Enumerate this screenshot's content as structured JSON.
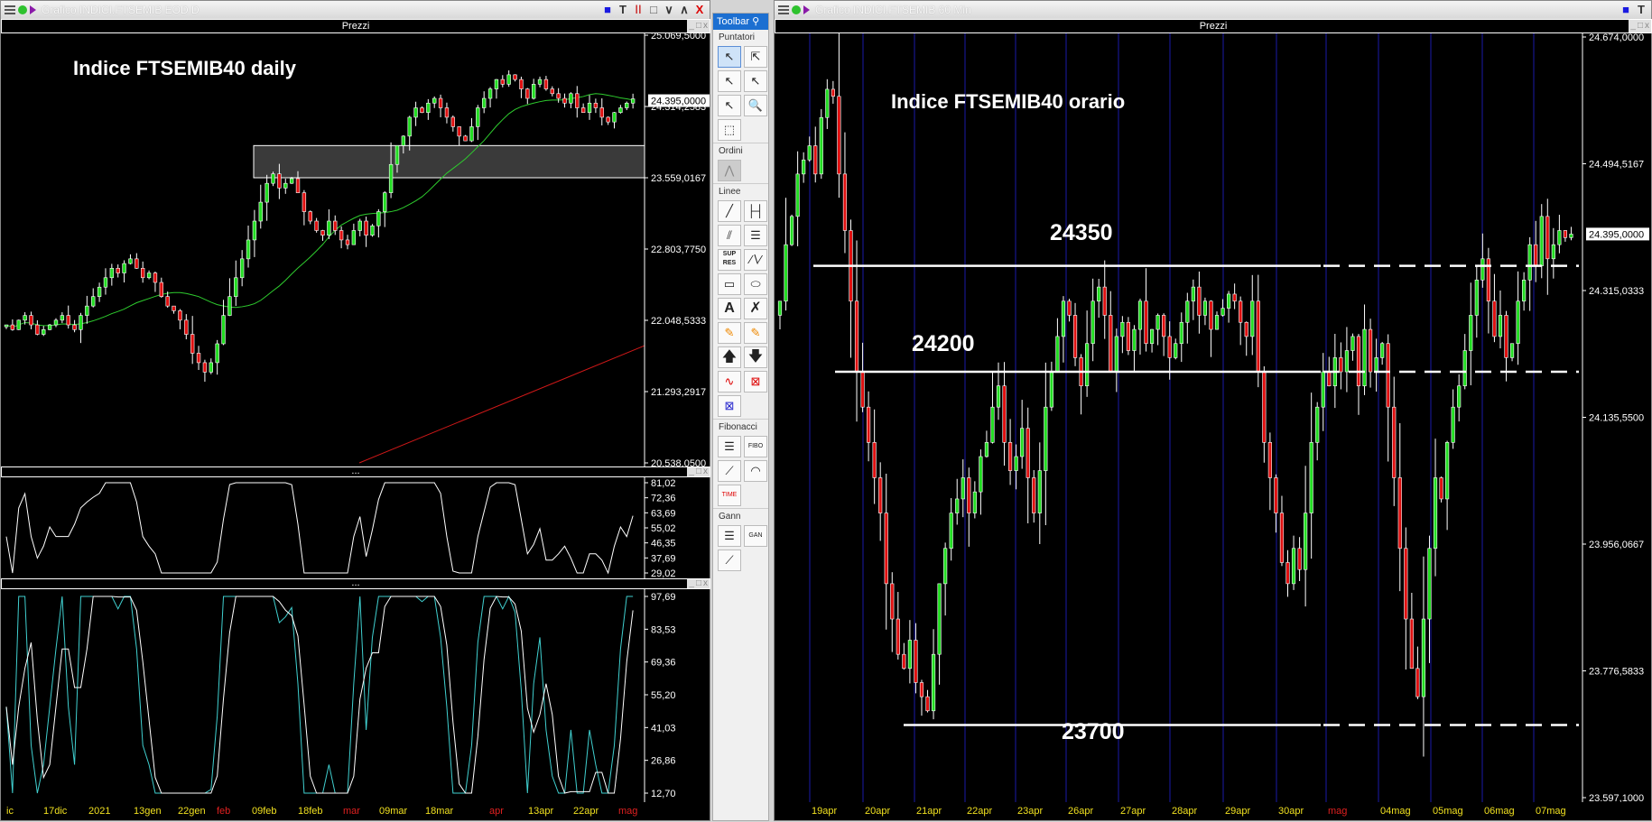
{
  "left_window": {
    "title": "Grafico INDICI.FTSEMIB EOD D",
    "pane_title": "Prezzi",
    "annotation": "Indice FTSEMIB40 daily",
    "price_axis": [
      "25.069,5000",
      "24.314,2583",
      "23.559,0167",
      "22.803,7750",
      "22.048,5333",
      "21.293,2917",
      "20.538,0500"
    ],
    "last_price": "24.395,0000",
    "ma_value": "24.314,2583",
    "rsi_axis": [
      "81,02",
      "72,36",
      "63,69",
      "55,02",
      "46,35",
      "37,69",
      "29,02"
    ],
    "stoch_axis": [
      "97,69",
      "83,53",
      "69,36",
      "55,20",
      "41,03",
      "26,86",
      "12,70"
    ],
    "pane_separator": "...",
    "dates": [
      {
        "t": "ic",
        "red": false
      },
      {
        "t": "17dic",
        "red": false
      },
      {
        "t": "2021",
        "red": false
      },
      {
        "t": "13gen",
        "red": false
      },
      {
        "t": "22gen",
        "red": false
      },
      {
        "t": "feb",
        "red": true
      },
      {
        "t": "09feb",
        "red": false
      },
      {
        "t": "18feb",
        "red": false
      },
      {
        "t": "mar",
        "red": true
      },
      {
        "t": "09mar",
        "red": false
      },
      {
        "t": "18mar",
        "red": false
      },
      {
        "t": "apr",
        "red": true
      },
      {
        "t": "13apr",
        "red": false
      },
      {
        "t": "22apr",
        "red": false
      },
      {
        "t": "mag",
        "red": true
      }
    ]
  },
  "right_window": {
    "title": "Grafico INDICI.FTSEMIB 60 Min",
    "pane_title": "Prezzi",
    "annotation": "Indice FTSEMIB40 orario",
    "price_axis": [
      "24.674,0000",
      "24.494,5167",
      "24.315,0333",
      "24.135,5500",
      "23.956,0667",
      "23.776,5833",
      "23.597,1000"
    ],
    "last_price": "24.395,0000",
    "levels": [
      {
        "label": "24350",
        "value": 24350
      },
      {
        "label": "24200",
        "value": 24200
      },
      {
        "label": "23700",
        "value": 23700
      }
    ],
    "dates": [
      {
        "t": "19apr",
        "red": false
      },
      {
        "t": "20apr",
        "red": false
      },
      {
        "t": "21apr",
        "red": false
      },
      {
        "t": "22apr",
        "red": false
      },
      {
        "t": "23apr",
        "red": false
      },
      {
        "t": "26apr",
        "red": false
      },
      {
        "t": "27apr",
        "red": false
      },
      {
        "t": "28apr",
        "red": false
      },
      {
        "t": "29apr",
        "red": false
      },
      {
        "t": "30apr",
        "red": false
      },
      {
        "t": "mag",
        "red": true
      },
      {
        "t": "04mag",
        "red": false
      },
      {
        "t": "05mag",
        "red": false
      },
      {
        "t": "06mag",
        "red": false
      },
      {
        "t": "07mag",
        "red": false
      }
    ]
  },
  "toolbar": {
    "title": "Toolbar",
    "sections": [
      {
        "name": "Puntatori",
        "tools": [
          "pointer",
          "pointer-info",
          "pointer-h",
          "pointer-v",
          "pointer-cross",
          "zoom"
        ]
      },
      {
        "name": "Ordini",
        "tools": [
          "orders"
        ]
      },
      {
        "name": "Linee",
        "tools": [
          "trendline",
          "segment",
          "channel",
          "parallel",
          "sup-res",
          "polyline",
          "rectangle",
          "ellipse",
          "text",
          "delete-line",
          "eraser",
          "eraser-all",
          "arrow-up",
          "arrow-down",
          "signal",
          "delete-signals",
          "delete-all"
        ]
      },
      {
        "name": "Fibonacci",
        "tools": [
          "fibo-lines",
          "fibo",
          "fibo-fan",
          "fibo-arc",
          "fibo-time"
        ]
      },
      {
        "name": "Gann",
        "tools": [
          "gann-lines",
          "gann",
          "gann-fan"
        ]
      }
    ]
  },
  "colors": {
    "up": "#22dd22",
    "down": "#e01010",
    "ma_short": "#2ecc2e",
    "ma_long": "#d01818",
    "rsi": "#ffffff",
    "stoch_k": "#40d0d0",
    "stoch_d": "#ffffff",
    "day_line": "#1a1aa8"
  },
  "chart_data": [
    {
      "type": "candlestick",
      "title": "Indice FTSEMIB40 daily",
      "ylim": [
        20538.05,
        25069.5
      ],
      "close": [
        22000,
        21950,
        22050,
        22100,
        22000,
        21900,
        21950,
        22000,
        22050,
        22100,
        22000,
        21950,
        22100,
        22200,
        22300,
        22400,
        22500,
        22600,
        22550,
        22650,
        22700,
        22600,
        22500,
        22550,
        22450,
        22300,
        22200,
        22150,
        22050,
        21900,
        21700,
        21600,
        21500,
        21600,
        21800,
        22100,
        22300,
        22500,
        22700,
        22900,
        23100,
        23300,
        23500,
        23600,
        23450,
        23500,
        23550,
        23400,
        23200,
        23100,
        23000,
        22950,
        23100,
        23000,
        22900,
        22850,
        23000,
        23100,
        22950,
        23050,
        23200,
        23400,
        23700,
        23900,
        24000,
        24200,
        24300,
        24250,
        24350,
        24400,
        24300,
        24200,
        24100,
        24000,
        23950,
        24100,
        24300,
        24400,
        24500,
        24600,
        24550,
        24650,
        24600,
        24500,
        24400,
        24550,
        24600,
        24500,
        24450,
        24400,
        24350,
        24450,
        24300,
        24250,
        24350,
        24300,
        24200,
        24150,
        24250,
        24300,
        24350,
        24395
      ],
      "zone": [
        23559,
        23900
      ]
    },
    {
      "type": "candlestick",
      "title": "Indice FTSEMIB40 orario",
      "ylim": [
        23597.1,
        24674
      ],
      "close": [
        24300,
        24380,
        24420,
        24480,
        24500,
        24520,
        24480,
        24560,
        24600,
        24590,
        24480,
        24400,
        24300,
        24200,
        24150,
        24100,
        24050,
        24000,
        23900,
        23850,
        23800,
        23780,
        23820,
        23760,
        23740,
        23720,
        23800,
        23900,
        23950,
        24000,
        24020,
        24050,
        24000,
        24030,
        24080,
        24100,
        24150,
        24180,
        24100,
        24060,
        24080,
        24120,
        24050,
        24000,
        24060,
        24150,
        24200,
        24250,
        24300,
        24280,
        24220,
        24180,
        24240,
        24300,
        24320,
        24280,
        24200,
        24250,
        24270,
        24230,
        24260,
        24300,
        24240,
        24260,
        24280,
        24250,
        24220,
        24240,
        24270,
        24300,
        24320,
        24280,
        24300,
        24260,
        24280,
        24290,
        24310,
        24300,
        24270,
        24250,
        24300,
        24200,
        24100,
        24050,
        24000,
        23930,
        23900,
        23950,
        23920,
        24000,
        24100,
        24150,
        24200,
        24180,
        24220,
        24200,
        24230,
        24250,
        24180,
        24260,
        24200,
        24220,
        24240,
        24150,
        24050,
        23950,
        23850,
        23780,
        23740,
        23850,
        23950,
        24050,
        24020,
        24100,
        24150,
        24180,
        24230,
        24280,
        24330,
        24360,
        24300,
        24250,
        24280,
        24220,
        24240,
        24300,
        24330,
        24380,
        24350,
        24420,
        24360,
        24380,
        24400,
        24390,
        24395
      ]
    }
  ]
}
